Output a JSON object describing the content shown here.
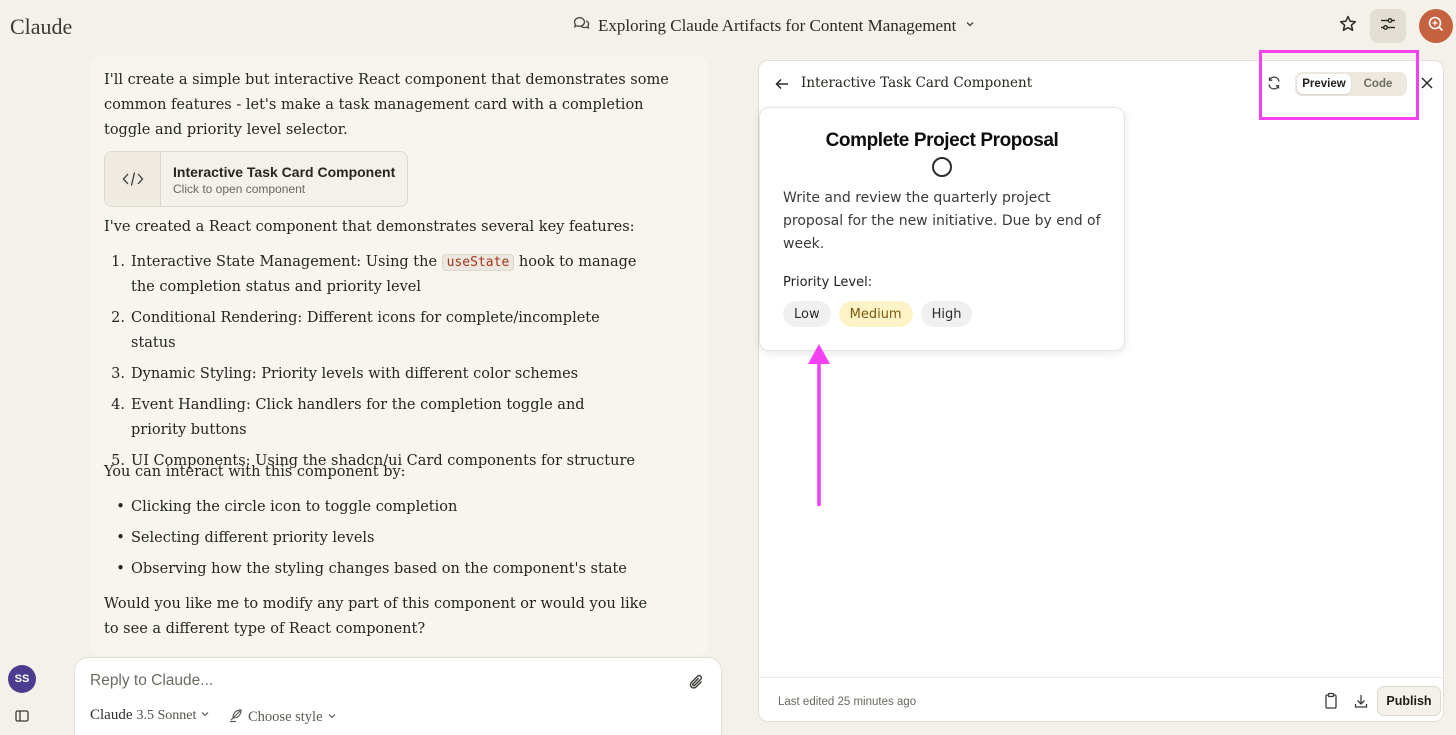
{
  "app": {
    "logo": "Claude",
    "conversation_title": "Exploring Claude Artifacts for Content Management"
  },
  "chat": {
    "intro": "I'll create a simple but interactive React component that demonstrates some common features - let's make a task management card with a completion toggle and priority level selector.",
    "artifact_chip": {
      "title": "Interactive Task Card Component",
      "subtitle": "Click to open component"
    },
    "features_intro": "I've created a React component that demonstrates several key features:",
    "features": [
      {
        "num": "1.",
        "pre": "Interactive State Management: Using the ",
        "code": "useState",
        "post": " hook to manage the completion status and priority level"
      },
      {
        "num": "2.",
        "text": "Conditional Rendering: Different icons for complete/incomplete status"
      },
      {
        "num": "3.",
        "text": "Dynamic Styling: Priority levels with different color schemes"
      },
      {
        "num": "4.",
        "text": "Event Handling: Click handlers for the completion toggle and priority buttons"
      },
      {
        "num": "5.",
        "text": "UI Components: Using the shadcn/ui Card components for structure"
      }
    ],
    "interact_intro": "You can interact with this component by:",
    "interactions": [
      "Clicking the circle icon to toggle completion",
      "Selecting different priority levels",
      "Observing how the styling changes based on the component's state"
    ],
    "closing": "Would you like me to modify any part of this component or would you like to see a different type of React component?"
  },
  "reply": {
    "placeholder": "Reply to Claude...",
    "model_name": "Claude",
    "model_version": "3.5 Sonnet",
    "style_label": "Choose style"
  },
  "user": {
    "initials": "SS",
    "avatar_color": "#4c3c8f"
  },
  "artifact": {
    "title": "Interactive Task Card Component",
    "tabs": {
      "preview": "Preview",
      "code": "Code",
      "active": "Preview"
    },
    "task": {
      "title": "Complete Project Proposal",
      "description": "Write and review the quarterly project proposal for the new initiative. Due by end of week.",
      "priority_label": "Priority Level:",
      "priorities": [
        "Low",
        "Medium",
        "High"
      ],
      "selected_priority": "Medium"
    },
    "footer": {
      "last_edited": "Last edited 25 minutes ago",
      "publish_label": "Publish"
    }
  },
  "colors": {
    "background": "#f4f1ea",
    "accent": "#c4623f",
    "annotation": "#f53ff2",
    "priority_selected": "#fdf3c6"
  },
  "icons": [
    "chat-bubbles-icon",
    "chevron-down-icon",
    "star-icon",
    "sliders-icon",
    "code-icon",
    "paperclip-icon",
    "sidebar-icon",
    "back-arrow-icon",
    "refresh-icon",
    "close-icon",
    "clipboard-icon",
    "download-icon",
    "feather-icon"
  ]
}
